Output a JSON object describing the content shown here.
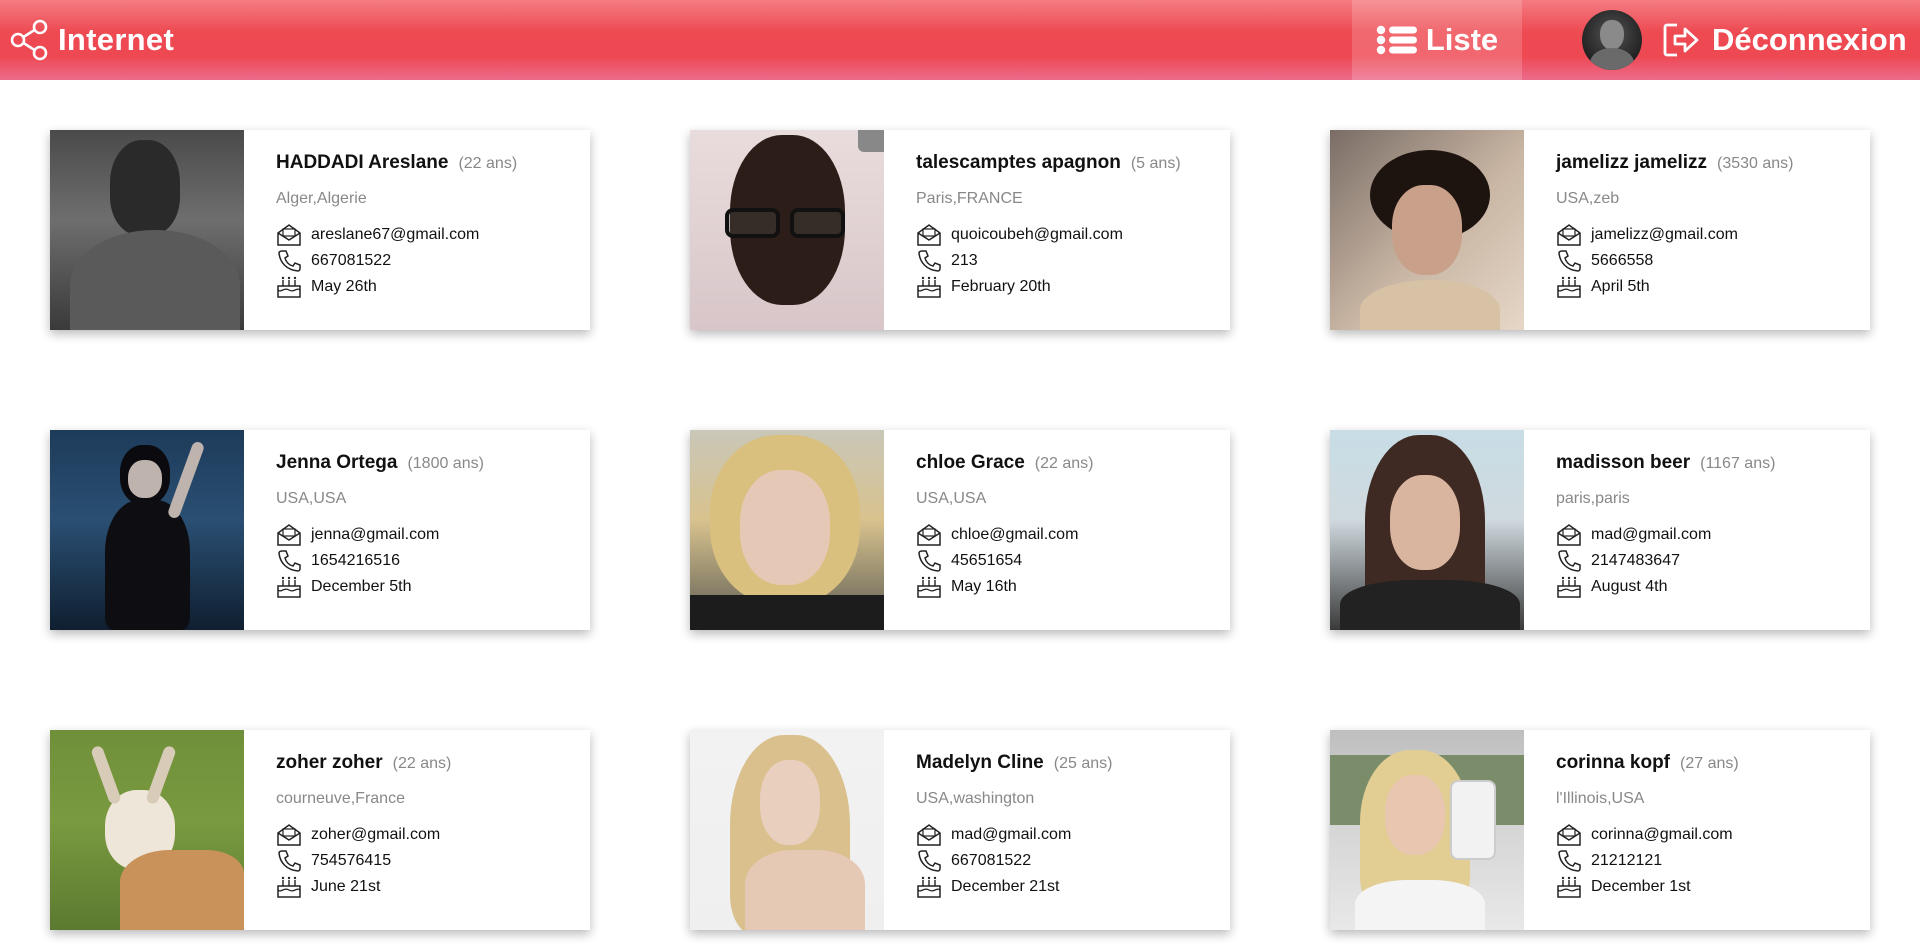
{
  "navbar": {
    "brand": "Internet",
    "liste_label": "Liste",
    "logout_label": "Déconnexion"
  },
  "cards": [
    {
      "name": "HADDADI Areslane",
      "age": "(22 ans)",
      "location": "Alger,Algerie",
      "email": "areslane67@gmail.com",
      "phone": "667081522",
      "birthday": "May 26th"
    },
    {
      "name": "talescamptes apagnon",
      "age": "(5 ans)",
      "location": "Paris,FRANCE",
      "email": "quoicoubeh@gmail.com",
      "phone": "213",
      "birthday": "February 20th"
    },
    {
      "name": "jamelizz jamelizz",
      "age": "(3530 ans)",
      "location": "USA,zeb",
      "email": "jamelizz@gmail.com",
      "phone": "5666558",
      "birthday": "April 5th"
    },
    {
      "name": "Jenna Ortega",
      "age": "(1800 ans)",
      "location": "USA,USA",
      "email": "jenna@gmail.com",
      "phone": "1654216516",
      "birthday": "December 5th"
    },
    {
      "name": "chloe Grace",
      "age": "(22 ans)",
      "location": "USA,USA",
      "email": "chloe@gmail.com",
      "phone": "45651654",
      "birthday": "May 16th"
    },
    {
      "name": "madisson beer",
      "age": "(1167 ans)",
      "location": "paris,paris",
      "email": "mad@gmail.com",
      "phone": "2147483647",
      "birthday": "August 4th"
    },
    {
      "name": "zoher zoher",
      "age": "(22 ans)",
      "location": "courneuve,France",
      "email": "zoher@gmail.com",
      "phone": "754576415",
      "birthday": "June 21st"
    },
    {
      "name": "Madelyn Cline",
      "age": "(25 ans)",
      "location": "USA,washington",
      "email": "mad@gmail.com",
      "phone": "667081522",
      "birthday": "December 21st"
    },
    {
      "name": "corinna kopf",
      "age": "(27 ans)",
      "location": "l'Illinois,USA",
      "email": "corinna@gmail.com",
      "phone": "21212121",
      "birthday": "December 1st"
    }
  ]
}
